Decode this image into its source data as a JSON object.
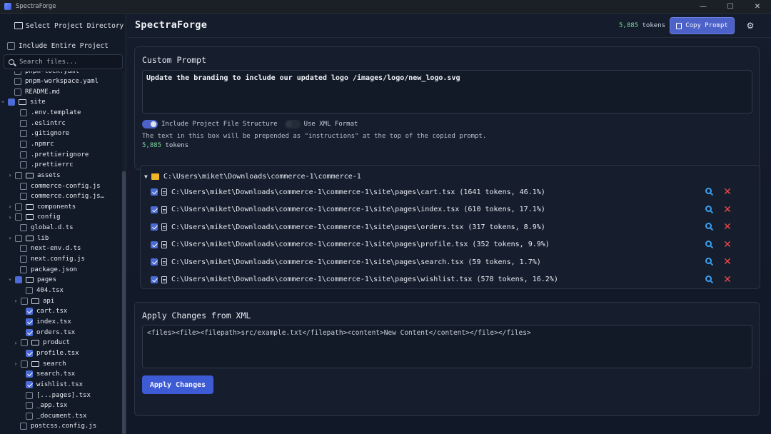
{
  "window": {
    "title": "SpectraForge",
    "controls": {
      "minimize": "—",
      "maximize": "☐",
      "close": "✕"
    }
  },
  "sidebar": {
    "select_dir_label": "Select Project Directory",
    "include_entire_label": "Include Entire Project",
    "search_placeholder": "Search files...",
    "tree": [
      {
        "name": "pnpm-lock.yaml",
        "depth": 1,
        "type": "file",
        "checked": false,
        "partial_visible": true
      },
      {
        "name": "pnpm-workspace.yaml",
        "depth": 1,
        "type": "file",
        "checked": false
      },
      {
        "name": "README.md",
        "depth": 1,
        "type": "file",
        "checked": false
      },
      {
        "name": "site",
        "depth": 0,
        "type": "folder",
        "expanded": true,
        "checked": "partial"
      },
      {
        "name": ".env.template",
        "depth": 2,
        "type": "file",
        "checked": false
      },
      {
        "name": ".eslintrc",
        "depth": 2,
        "type": "file",
        "checked": false
      },
      {
        "name": ".gitignore",
        "depth": 2,
        "type": "file",
        "checked": false
      },
      {
        "name": ".npmrc",
        "depth": 2,
        "type": "file",
        "checked": false
      },
      {
        "name": ".prettierignore",
        "depth": 2,
        "type": "file",
        "checked": false
      },
      {
        "name": ".prettierrc",
        "depth": 2,
        "type": "file",
        "checked": false
      },
      {
        "name": "assets",
        "depth": 1,
        "type": "folder",
        "expanded": false,
        "checked": false
      },
      {
        "name": "commerce-config.js",
        "depth": 2,
        "type": "file",
        "checked": false
      },
      {
        "name": "commerce.config.json",
        "depth": 2,
        "type": "file",
        "checked": false
      },
      {
        "name": "components",
        "depth": 1,
        "type": "folder",
        "expanded": false,
        "checked": false
      },
      {
        "name": "config",
        "depth": 1,
        "type": "folder",
        "expanded": false,
        "checked": false
      },
      {
        "name": "global.d.ts",
        "depth": 2,
        "type": "file",
        "checked": false
      },
      {
        "name": "lib",
        "depth": 1,
        "type": "folder",
        "expanded": false,
        "checked": false
      },
      {
        "name": "next-env.d.ts",
        "depth": 2,
        "type": "file",
        "checked": false
      },
      {
        "name": "next.config.js",
        "depth": 2,
        "type": "file",
        "checked": false
      },
      {
        "name": "package.json",
        "depth": 2,
        "type": "file",
        "checked": false
      },
      {
        "name": "pages",
        "depth": 1,
        "type": "folder",
        "expanded": true,
        "checked": "partial"
      },
      {
        "name": "404.tsx",
        "depth": 3,
        "type": "file",
        "checked": false
      },
      {
        "name": "api",
        "depth": 2,
        "type": "folder",
        "expanded": false,
        "checked": false
      },
      {
        "name": "cart.tsx",
        "depth": 3,
        "type": "file",
        "checked": true
      },
      {
        "name": "index.tsx",
        "depth": 3,
        "type": "file",
        "checked": true
      },
      {
        "name": "orders.tsx",
        "depth": 3,
        "type": "file",
        "checked": true
      },
      {
        "name": "product",
        "depth": 2,
        "type": "folder",
        "expanded": false,
        "checked": false
      },
      {
        "name": "profile.tsx",
        "depth": 3,
        "type": "file",
        "checked": true
      },
      {
        "name": "search",
        "depth": 2,
        "type": "folder",
        "expanded": false,
        "checked": false
      },
      {
        "name": "search.tsx",
        "depth": 3,
        "type": "file",
        "checked": true
      },
      {
        "name": "wishlist.tsx",
        "depth": 3,
        "type": "file",
        "checked": true
      },
      {
        "name": "[...pages].tsx",
        "depth": 3,
        "type": "file",
        "checked": false
      },
      {
        "name": "_app.tsx",
        "depth": 3,
        "type": "file",
        "checked": false
      },
      {
        "name": "_document.tsx",
        "depth": 3,
        "type": "file",
        "checked": false
      },
      {
        "name": "postcss.config.js",
        "depth": 2,
        "type": "file",
        "checked": false
      }
    ]
  },
  "header": {
    "brand": "SpectraForge",
    "token_count": "5,885",
    "token_suffix": " tokens",
    "copy_label": "Copy Prompt",
    "settings_icon": "gear-icon"
  },
  "prompt": {
    "title": "Custom Prompt",
    "text": "Update the branding to include our updated logo /images/logo/new_logo.svg",
    "toggle_structure_label": "Include Project File Structure",
    "toggle_structure_on": true,
    "toggle_xml_label": "Use XML Format",
    "toggle_xml_on": false,
    "helper": "The text in this box will be prepended as \"instructions\" at the top of the copied prompt.",
    "token_count": "5,885",
    "token_suffix": " tokens"
  },
  "selected": {
    "root_path": "C:\\Users\\miket\\Downloads\\commerce-1\\commerce-1",
    "files": [
      {
        "path": "C:\\Users\\miket\\Downloads\\commerce-1\\commerce-1\\site\\pages\\cart.tsx (1641 tokens, 46.1%)"
      },
      {
        "path": "C:\\Users\\miket\\Downloads\\commerce-1\\commerce-1\\site\\pages\\index.tsx (610 tokens, 17.1%)"
      },
      {
        "path": "C:\\Users\\miket\\Downloads\\commerce-1\\commerce-1\\site\\pages\\orders.tsx (317 tokens, 8.9%)"
      },
      {
        "path": "C:\\Users\\miket\\Downloads\\commerce-1\\commerce-1\\site\\pages\\profile.tsx (352 tokens, 9.9%)"
      },
      {
        "path": "C:\\Users\\miket\\Downloads\\commerce-1\\commerce-1\\site\\pages\\search.tsx (59 tokens, 1.7%)"
      },
      {
        "path": "C:\\Users\\miket\\Downloads\\commerce-1\\commerce-1\\site\\pages\\wishlist.tsx (578 tokens, 16.2%)"
      }
    ]
  },
  "xml": {
    "title": "Apply Changes from XML",
    "placeholder": "<files><file><filepath>src/example.txt</filepath><content>New Content</content></file></files>",
    "apply_label": "Apply Changes"
  },
  "colors": {
    "accent": "#4d62c9",
    "token_green": "#7cd39a",
    "remove_red": "#f04848",
    "search_blue": "#3aa0f0",
    "folder_yellow": "#f0b429"
  }
}
